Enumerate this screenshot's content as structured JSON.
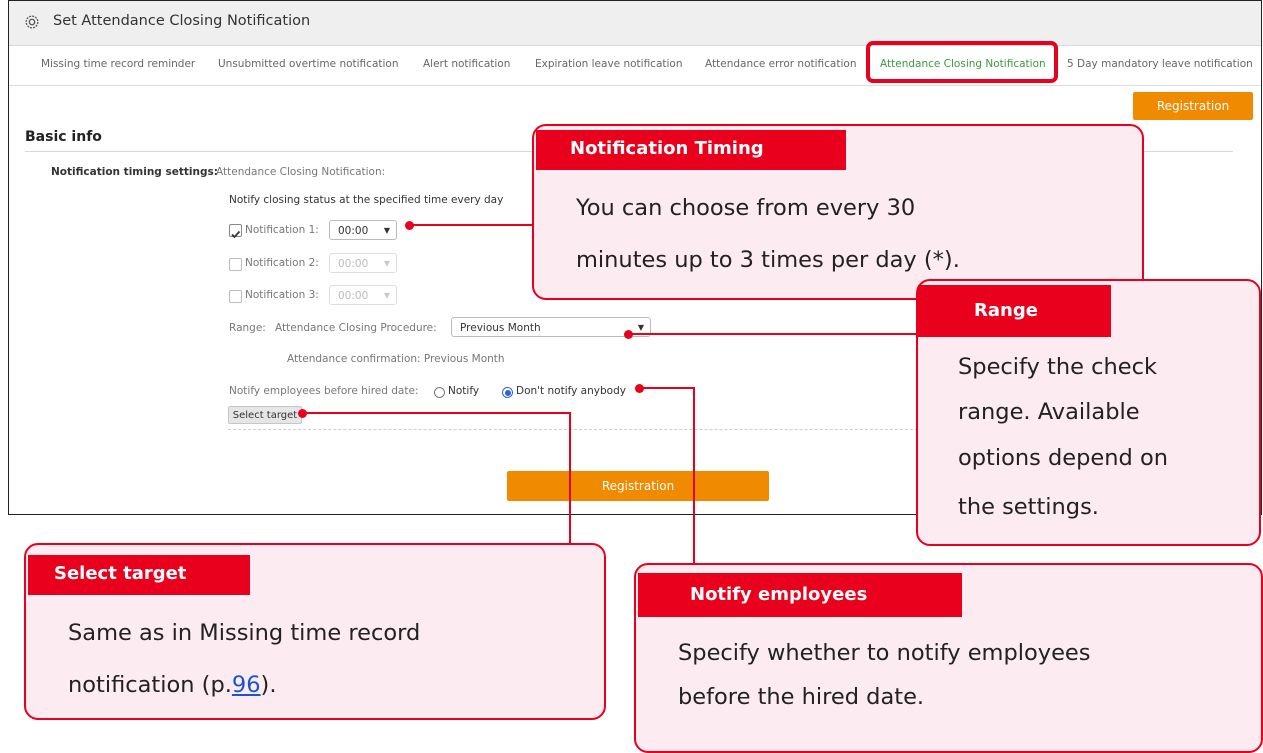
{
  "window": {
    "title": "Set Attendance Closing Notification"
  },
  "tabs": [
    {
      "label": "Missing time record reminder"
    },
    {
      "label": "Unsubmitted overtime notification"
    },
    {
      "label": "Alert notification"
    },
    {
      "label": "Expiration leave notification"
    },
    {
      "label": "Attendance error notification"
    },
    {
      "label": "Attendance Closing Notification",
      "active": true
    },
    {
      "label": "5 Day mandatory leave notification"
    }
  ],
  "registration_label": "Registration",
  "section": {
    "title": "Basic info",
    "timing_label": "Notification timing settings:",
    "timing_value": "Attendance Closing Notification:",
    "notify_desc": "Notify closing status at the specified time every day",
    "notifications": [
      {
        "label": "Notification 1:",
        "time": "00:00",
        "checked": true
      },
      {
        "label": "Notification 2:",
        "time": "00:00",
        "checked": false
      },
      {
        "label": "Notification 3:",
        "time": "00:00",
        "checked": false
      }
    ],
    "range_label": "Range:",
    "procedure_label": "Attendance Closing Procedure:",
    "procedure_value": "Previous Month",
    "confirmation_text": "Attendance confirmation: Previous Month",
    "hired_label": "Notify employees before hired date:",
    "radio_notify": "Notify",
    "radio_dont": "Don't notify anybody",
    "select_target": "Select target"
  },
  "callouts": {
    "timing": {
      "title": "Notification Timing",
      "line1": "You can choose from every 30",
      "line2": "minutes up to 3 times per day (*)."
    },
    "range": {
      "title": "Range",
      "line1": "Specify the check",
      "line2": "range. Available",
      "line3": "options depend on",
      "line4": "the settings."
    },
    "select_target": {
      "title": "Select target",
      "line1": "Same as in Missing time record",
      "line2_prefix": "notification (p.",
      "page": "96",
      "line2_suffix": ")."
    },
    "notify": {
      "title": "Notify employees",
      "line1": "Specify whether to notify employees",
      "line2": "before the hired date."
    }
  },
  "colors": {
    "accent_red": "#e8001c",
    "callout_bg": "#fdebf2",
    "button_orange": "#f08a00",
    "active_tab": "#3a9a3a"
  }
}
